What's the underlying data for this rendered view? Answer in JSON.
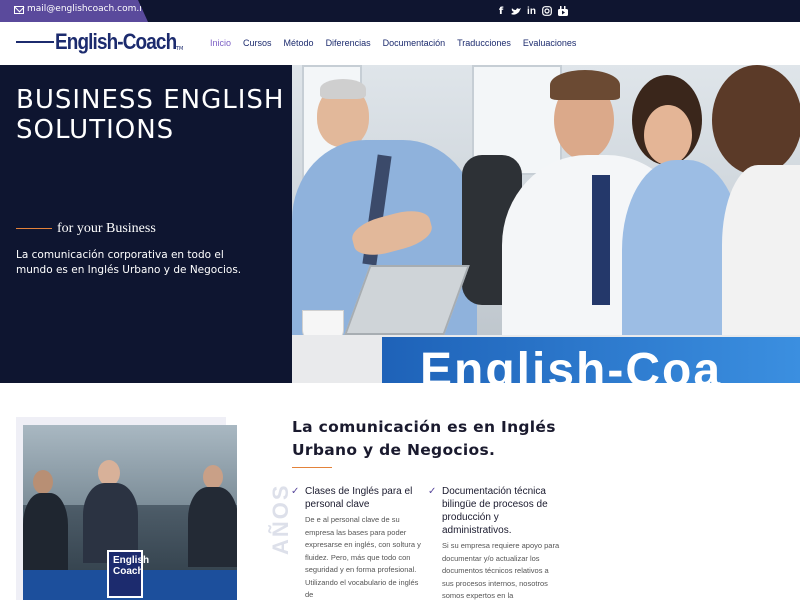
{
  "topbar": {
    "email": "mail@englishcoach.com.mx",
    "social_icons": [
      "facebook-icon",
      "twitter-icon",
      "linkedin-icon",
      "instagram-icon",
      "youtube-icon"
    ]
  },
  "header": {
    "logo_text": "English-Coach",
    "logo_tm": "TM",
    "nav": [
      "Inicio",
      "Cursos",
      "Método",
      "Diferencias",
      "Documentación",
      "Traducciones",
      "Evaluaciones"
    ],
    "active_nav": "Inicio"
  },
  "hero": {
    "title_line1": "BUSINESS ENGLISH",
    "title_line2": "SOLUTIONS",
    "subtitle": "for your Business",
    "description": "La comunicación corporativa en todo el mundo es en Inglés Urbano y de Negocios.",
    "photo_brand_text": "English-Coa"
  },
  "about": {
    "badge_line1": "English",
    "badge_line2": "Coach",
    "vertical_text": "AÑOS",
    "title": "La comunicación es en Inglés Urbano y de Negocios.",
    "features": [
      {
        "title": "Clases de Inglés para el personal clave",
        "body": "De e al personal clave de su empresa las bases para poder expresarse en inglés, con soltura y fluidez. Pero, más que todo con seguridad y en forma profesional. Utilizando el vocabulario de inglés de"
      },
      {
        "title": "Documentación técnica bilingüe de procesos de producción y administrativos.",
        "body": "Si su empresa requiere apoyo para documentar y/o actualizar los documentos técnicos relativos a sus procesos internos, nosotros somos expertos en la"
      }
    ]
  },
  "colors": {
    "navy": "#0e1530",
    "brand_blue": "#1c2b6e",
    "purple": "#5a4a9c",
    "accent_orange": "#e3823a"
  }
}
